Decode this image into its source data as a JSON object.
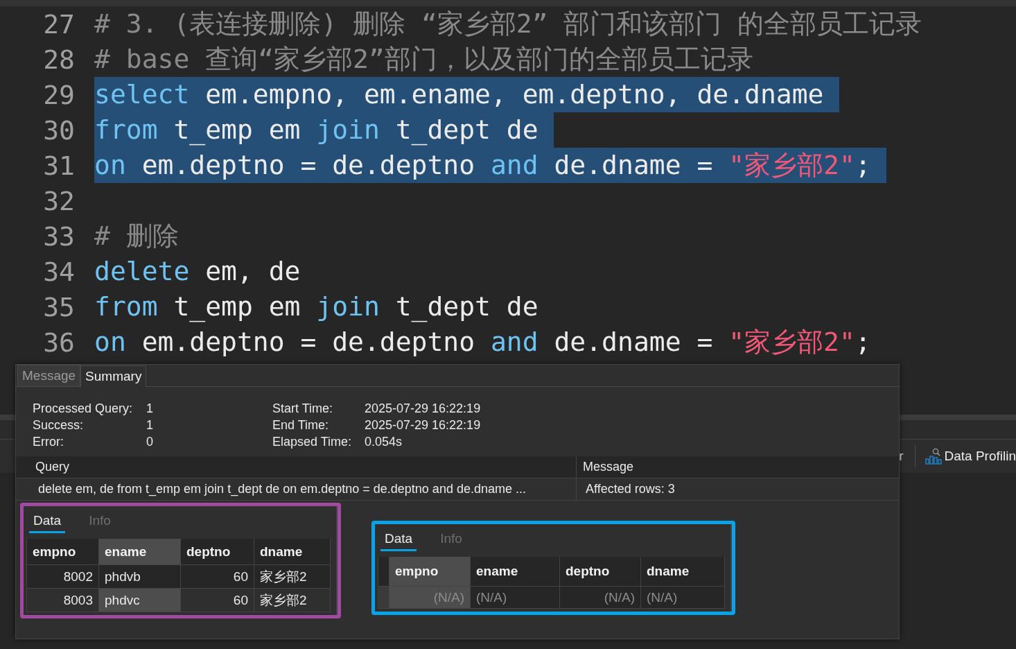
{
  "editor": {
    "lines": [
      {
        "number": "27",
        "selected": false,
        "tokens": [
          {
            "kind": "comment",
            "text": "# 3. (表连接删除) 删除 “家乡部2” 部门和该部门 的全部员工记录"
          }
        ]
      },
      {
        "number": "28",
        "selected": false,
        "tokens": [
          {
            "kind": "comment",
            "text": "# base 查询“家乡部2”部门，以及部门的全部员工记录"
          }
        ]
      },
      {
        "number": "29",
        "selected": true,
        "tokens": [
          {
            "kind": "keyword",
            "text": "select"
          },
          {
            "kind": "plain",
            "text": " em.empno, em.ename, em.deptno, de.dname"
          }
        ]
      },
      {
        "number": "30",
        "selected": true,
        "tokens": [
          {
            "kind": "keyword",
            "text": "from"
          },
          {
            "kind": "plain",
            "text": " t_emp em "
          },
          {
            "kind": "keyword",
            "text": "join"
          },
          {
            "kind": "plain",
            "text": " t_dept de"
          }
        ]
      },
      {
        "number": "31",
        "selected": true,
        "tokens": [
          {
            "kind": "keyword",
            "text": "on"
          },
          {
            "kind": "plain",
            "text": " em.deptno = de.deptno "
          },
          {
            "kind": "keyword",
            "text": "and"
          },
          {
            "kind": "plain",
            "text": " de.dname = "
          },
          {
            "kind": "string",
            "text": "\"家乡部2\""
          },
          {
            "kind": "plain",
            "text": ";"
          }
        ]
      },
      {
        "number": "32"
      },
      {
        "number": "33",
        "selected": false,
        "tokens": [
          {
            "kind": "comment",
            "text": "# 删除"
          }
        ]
      },
      {
        "number": "34",
        "selected": false,
        "tokens": [
          {
            "kind": "keyword",
            "text": "delete"
          },
          {
            "kind": "plain",
            "text": " em, de"
          }
        ]
      },
      {
        "number": "35",
        "selected": false,
        "tokens": [
          {
            "kind": "keyword",
            "text": "from"
          },
          {
            "kind": "plain",
            "text": " t_emp em "
          },
          {
            "kind": "keyword",
            "text": "join"
          },
          {
            "kind": "plain",
            "text": " t_dept de"
          }
        ]
      },
      {
        "number": "36",
        "selected": false,
        "tokens": [
          {
            "kind": "keyword",
            "text": "on"
          },
          {
            "kind": "plain",
            "text": " em.deptno = de.deptno "
          },
          {
            "kind": "keyword",
            "text": "and"
          },
          {
            "kind": "plain",
            "text": " de.dname = "
          },
          {
            "kind": "string",
            "text": "\"家乡部2\""
          },
          {
            "kind": "plain",
            "text": ";"
          }
        ]
      }
    ]
  },
  "results_toolbar": {
    "cut_button": "r",
    "data_profiling_button": "Data Profilin"
  },
  "summary_dialog": {
    "tabs": [
      {
        "label": "Message",
        "selected": false
      },
      {
        "label": "Summary",
        "selected": true
      }
    ],
    "stats_left": [
      {
        "label": "Processed Query:",
        "value": "1"
      },
      {
        "label": "Success:",
        "value": "1"
      },
      {
        "label": "Error:",
        "value": "0"
      }
    ],
    "stats_right": [
      {
        "label": "Start Time:",
        "value": "2025-07-29 16:22:19"
      },
      {
        "label": "End Time:",
        "value": "2025-07-29 16:22:19"
      },
      {
        "label": "Elapsed Time:",
        "value": "0.054s"
      }
    ],
    "query_table": {
      "columns": [
        "Query",
        "Message"
      ],
      "rows": [
        [
          "delete em, de from t_emp em join t_dept de on em.deptno = de.deptno and de.dname ...",
          "Affected rows: 3"
        ]
      ]
    },
    "result_panels": [
      {
        "color": "#a04aa0",
        "row_indicator": false,
        "tabs": [
          {
            "label": "Data",
            "selected": true
          },
          {
            "label": "Info",
            "selected": false
          }
        ],
        "columns": [
          {
            "label": "empno",
            "kind": "number",
            "selected": false
          },
          {
            "label": "ename",
            "kind": "text",
            "selected": true
          },
          {
            "label": "deptno",
            "kind": "number",
            "selected": false
          },
          {
            "label": "dname",
            "kind": "text",
            "selected": false
          }
        ],
        "rows": [
          {
            "kind": "data",
            "cells": [
              {
                "text": "8002",
                "selected": false
              },
              {
                "text": "phdvb",
                "selected": false
              },
              {
                "text": "60",
                "selected": false
              },
              {
                "text": "家乡部2",
                "selected": false
              }
            ]
          },
          {
            "kind": "data",
            "cells": [
              {
                "text": "8003",
                "selected": false
              },
              {
                "text": "phdvc",
                "selected": true
              },
              {
                "text": "60",
                "selected": false
              },
              {
                "text": "家乡部2",
                "selected": false
              }
            ]
          }
        ]
      },
      {
        "color": "#0aa3e8",
        "row_indicator": true,
        "tabs": [
          {
            "label": "Data",
            "selected": true
          },
          {
            "label": "Info",
            "selected": false
          }
        ],
        "columns": [
          {
            "label": "empno",
            "kind": "number",
            "selected": true
          },
          {
            "label": "ename",
            "kind": "text",
            "selected": false
          },
          {
            "label": "deptno",
            "kind": "number",
            "selected": false
          },
          {
            "label": "dname",
            "kind": "text",
            "selected": false
          }
        ],
        "rows": [
          {
            "kind": "null",
            "cells": [
              {
                "text": "(N/A)",
                "selected": true
              },
              {
                "text": "(N/A)",
                "selected": false
              },
              {
                "text": "(N/A)",
                "selected": false
              },
              {
                "text": "(N/A)",
                "selected": false
              }
            ]
          }
        ]
      }
    ]
  }
}
